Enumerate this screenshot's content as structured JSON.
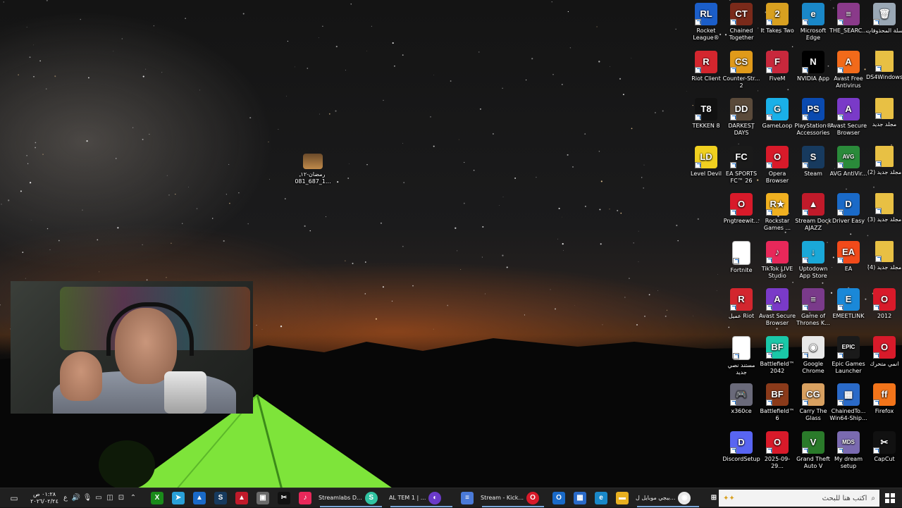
{
  "desktop": {
    "center_file": {
      "label": "رمضان-١٢ 1_687_081...",
      "icon": "video-thumbnail-icon"
    },
    "icons": [
      {
        "id": "rocket-league",
        "label": "Rocket League®",
        "color": "#1b5ec9",
        "glyph": "RL"
      },
      {
        "id": "chained-together",
        "label": "Chained Together",
        "color": "#7a2a1a",
        "glyph": "CT"
      },
      {
        "id": "it-takes-two",
        "label": "It Takes Two",
        "color": "#d8a020",
        "glyph": "2"
      },
      {
        "id": "microsoft-edge",
        "label": "Microsoft Edge",
        "color": "#1a88c8",
        "glyph": "e"
      },
      {
        "id": "the-search",
        "label": "THE_SEARC...",
        "color": "#8a3a8a",
        "glyph": "≡"
      },
      {
        "id": "recycle-bin",
        "label": "سلة المحذوفات",
        "color": "#9aa8b5",
        "glyph": "🗑"
      },
      {
        "id": "riot-client",
        "label": "Riot Client",
        "color": "#d3262e",
        "glyph": "R"
      },
      {
        "id": "counter-strike-2",
        "label": "Counter-Str... 2",
        "color": "#e09a1a",
        "glyph": "CS"
      },
      {
        "id": "fivem",
        "label": "FiveM",
        "color": "#c8283c",
        "glyph": "F"
      },
      {
        "id": "nvidia-app",
        "label": "NVIDIA App",
        "color": "#000000",
        "glyph": "N"
      },
      {
        "id": "avast-free-antivirus",
        "label": "Avast Free Antivirus",
        "color": "#f26a1a",
        "glyph": "A"
      },
      {
        "id": "ds4windows",
        "label": "DS4Windows",
        "color": "#e8c044",
        "glyph": ""
      },
      {
        "id": "tekken-8",
        "label": "TEKKEN 8",
        "color": "#111111",
        "glyph": "T8"
      },
      {
        "id": "darkest-days",
        "label": "DARKEST DAYS",
        "color": "#5a4a3a",
        "glyph": "DD"
      },
      {
        "id": "gameloop",
        "label": "GameLoop",
        "color": "#1ab0e8",
        "glyph": "G"
      },
      {
        "id": "playstation-accessories",
        "label": "PlayStation® Accessories",
        "color": "#0a4ab0",
        "glyph": "PS"
      },
      {
        "id": "avast-secure-browser",
        "label": "Avast Secure Browser",
        "color": "#7a3ac8",
        "glyph": "A"
      },
      {
        "id": "new-folder",
        "label": "مجلد جديد",
        "color": "#e8c044",
        "glyph": ""
      },
      {
        "id": "level-devil",
        "label": "Level Devil",
        "color": "#f0d020",
        "glyph": "LD"
      },
      {
        "id": "ea-sports-fc-26",
        "label": "EA SPORTS FC™ 26",
        "color": "#1a1a1a",
        "glyph": "FC"
      },
      {
        "id": "opera-browser",
        "label": "Opera Browser",
        "color": "#d81a2a",
        "glyph": "O"
      },
      {
        "id": "steam",
        "label": "Steam",
        "color": "#173a5e",
        "glyph": "S"
      },
      {
        "id": "avg-antivirus",
        "label": "AVG AntiVir...",
        "color": "#2a8a3a",
        "glyph": "AVG"
      },
      {
        "id": "new-folder-2",
        "label": "مجلد جديد (2)",
        "color": "#e8c044",
        "glyph": ""
      },
      {
        "id": "pngtreewit",
        "label": "Pngtreewit...",
        "color": "#d81a2a",
        "glyph": "O"
      },
      {
        "id": "rockstar-games",
        "label": "Rockstar Games ...",
        "color": "#f0b020",
        "glyph": "R★"
      },
      {
        "id": "stream-dock-ajazz",
        "label": "Stream Dock AJAZZ",
        "color": "#c01a2a",
        "glyph": "▲"
      },
      {
        "id": "driver-easy",
        "label": "Driver Easy",
        "color": "#1a6ac8",
        "glyph": "D"
      },
      {
        "id": "new-folder-3",
        "label": "مجلد جديد (3)",
        "color": "#e8c044",
        "glyph": ""
      },
      {
        "id": "fortnite",
        "label": "Fortnite",
        "color": "#ffffff",
        "glyph": ""
      },
      {
        "id": "tiktok-live-studio",
        "label": "TikTok LIVE Studio",
        "color": "#e8285a",
        "glyph": "♪"
      },
      {
        "id": "uptodown-app-store",
        "label": "Uptodown App Store",
        "color": "#1aa8d8",
        "glyph": "↓"
      },
      {
        "id": "ea",
        "label": "EA",
        "color": "#f24a1a",
        "glyph": "EA"
      },
      {
        "id": "new-folder-4",
        "label": "مجلد جديد (4)",
        "color": "#e8c044",
        "glyph": ""
      },
      {
        "id": "riot-client-ar",
        "label": "عميل Riot",
        "color": "#d3262e",
        "glyph": "R"
      },
      {
        "id": "avast-secure-browser-2",
        "label": "Avast Secure Browser",
        "color": "#7a3ac8",
        "glyph": "A"
      },
      {
        "id": "game-of-thrones",
        "label": "Game of Thrones K...",
        "color": "#7a3a8a",
        "glyph": "≡"
      },
      {
        "id": "emeetlink",
        "label": "EMEETLINK",
        "color": "#1a88d8",
        "glyph": "E"
      },
      {
        "id": "opera-2012",
        "label": "2012",
        "color": "#d81a2a",
        "glyph": "O"
      },
      {
        "id": "new-text-document",
        "label": "مستند نصي جديد",
        "color": "#ffffff",
        "glyph": ""
      },
      {
        "id": "battlefield-2042",
        "label": "Battlefield™ 2042",
        "color": "#1ac8a8",
        "glyph": "BF"
      },
      {
        "id": "google-chrome",
        "label": "Google Chrome",
        "color": "#e8e8e8",
        "glyph": "◉"
      },
      {
        "id": "epic-games-launcher",
        "label": "Epic Games Launcher",
        "color": "#1a1a1a",
        "glyph": "EPIC"
      },
      {
        "id": "opera-mutaharrik",
        "label": "انمي متحرك",
        "color": "#d81a2a",
        "glyph": "O"
      },
      {
        "id": "x360ce",
        "label": "x360ce",
        "color": "#6a6a7a",
        "glyph": "🎮"
      },
      {
        "id": "battlefield-6",
        "label": "Battlefield™ 6",
        "color": "#8a3a1a",
        "glyph": "BF"
      },
      {
        "id": "carry-the-glass",
        "label": "Carry The Glass",
        "color": "#d8a060",
        "glyph": "CG"
      },
      {
        "id": "chainedtogether-win64",
        "label": "ChainedTo... Win64-Ship...",
        "color": "#2a6ac8",
        "glyph": "▦"
      },
      {
        "id": "firefox",
        "label": "Firefox",
        "color": "#f2741a",
        "glyph": "ff"
      },
      {
        "id": "discord-setup",
        "label": "DiscordSetup",
        "color": "#5865f2",
        "glyph": "D"
      },
      {
        "id": "opera-2025",
        "label": "2025-09-29...",
        "color": "#d81a2a",
        "glyph": "O"
      },
      {
        "id": "gta-v",
        "label": "Grand Theft Auto V",
        "color": "#2a7a2a",
        "glyph": "V"
      },
      {
        "id": "my-dream-setup",
        "label": "My dream setup",
        "color": "#7a6ab0",
        "glyph": "MDS"
      },
      {
        "id": "capcut",
        "label": "CapCut",
        "color": "#111111",
        "glyph": "✂"
      }
    ]
  },
  "taskbar": {
    "start_icon": "windows-start-icon",
    "search_placeholder": "اكتب هنا للبحث",
    "clock_time": "٠١:٢٨ ص",
    "clock_date": "٢٠٢٦/٠٢/٢٤",
    "lang": "ع",
    "apps": [
      {
        "id": "pubg-chrome",
        "label": "ببجي موبايل ل...",
        "color": "#e8e8e8",
        "glyph": "◉"
      },
      {
        "id": "kick-stream",
        "label": "Stream - Kick...",
        "color": "#d81a2a",
        "glyph": "O"
      },
      {
        "id": "al-tem",
        "label": "AL TEM 1 | ...",
        "color": "#6a3ac8",
        "glyph": "◐"
      },
      {
        "id": "streamlabs",
        "label": "Streamlabs D...",
        "color": "#31c3a2",
        "glyph": "S"
      }
    ],
    "pinned": [
      {
        "id": "task-view",
        "glyph": "⊞",
        "color": "#202020"
      },
      {
        "id": "file-explorer",
        "glyph": "▬",
        "color": "#e8b020"
      },
      {
        "id": "edge",
        "glyph": "e",
        "color": "#1a88c8"
      },
      {
        "id": "store",
        "glyph": "▦",
        "color": "#2a6ac8"
      },
      {
        "id": "outlook",
        "glyph": "O",
        "color": "#1a6ac8"
      },
      {
        "id": "notepad",
        "glyph": "≡",
        "color": "#4a7ad8"
      },
      {
        "id": "tiktok",
        "glyph": "♪",
        "color": "#e8285a"
      },
      {
        "id": "capcut",
        "glyph": "✂",
        "color": "#111111"
      },
      {
        "id": "photos",
        "glyph": "▣",
        "color": "#6a6a6a"
      },
      {
        "id": "stream-dock",
        "glyph": "▲",
        "color": "#c01a2a"
      },
      {
        "id": "steam",
        "glyph": "S",
        "color": "#173a5e"
      },
      {
        "id": "onedrive-photo",
        "glyph": "▲",
        "color": "#1a6ac8"
      },
      {
        "id": "telegram",
        "glyph": "➤",
        "color": "#2aa0d8"
      },
      {
        "id": "xbox",
        "glyph": "X",
        "color": "#1a8a1a"
      }
    ]
  }
}
